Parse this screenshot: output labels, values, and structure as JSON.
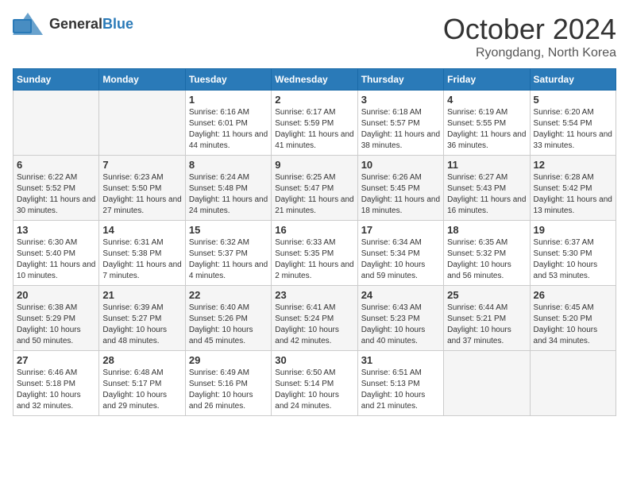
{
  "header": {
    "logo_general": "General",
    "logo_blue": "Blue",
    "month": "October 2024",
    "location": "Ryongdang, North Korea"
  },
  "weekdays": [
    "Sunday",
    "Monday",
    "Tuesday",
    "Wednesday",
    "Thursday",
    "Friday",
    "Saturday"
  ],
  "weeks": [
    [
      {
        "day": "",
        "sunrise": "",
        "sunset": "",
        "daylight": ""
      },
      {
        "day": "",
        "sunrise": "",
        "sunset": "",
        "daylight": ""
      },
      {
        "day": "1",
        "sunrise": "Sunrise: 6:16 AM",
        "sunset": "Sunset: 6:01 PM",
        "daylight": "Daylight: 11 hours and 44 minutes."
      },
      {
        "day": "2",
        "sunrise": "Sunrise: 6:17 AM",
        "sunset": "Sunset: 5:59 PM",
        "daylight": "Daylight: 11 hours and 41 minutes."
      },
      {
        "day": "3",
        "sunrise": "Sunrise: 6:18 AM",
        "sunset": "Sunset: 5:57 PM",
        "daylight": "Daylight: 11 hours and 38 minutes."
      },
      {
        "day": "4",
        "sunrise": "Sunrise: 6:19 AM",
        "sunset": "Sunset: 5:55 PM",
        "daylight": "Daylight: 11 hours and 36 minutes."
      },
      {
        "day": "5",
        "sunrise": "Sunrise: 6:20 AM",
        "sunset": "Sunset: 5:54 PM",
        "daylight": "Daylight: 11 hours and 33 minutes."
      }
    ],
    [
      {
        "day": "6",
        "sunrise": "Sunrise: 6:22 AM",
        "sunset": "Sunset: 5:52 PM",
        "daylight": "Daylight: 11 hours and 30 minutes."
      },
      {
        "day": "7",
        "sunrise": "Sunrise: 6:23 AM",
        "sunset": "Sunset: 5:50 PM",
        "daylight": "Daylight: 11 hours and 27 minutes."
      },
      {
        "day": "8",
        "sunrise": "Sunrise: 6:24 AM",
        "sunset": "Sunset: 5:48 PM",
        "daylight": "Daylight: 11 hours and 24 minutes."
      },
      {
        "day": "9",
        "sunrise": "Sunrise: 6:25 AM",
        "sunset": "Sunset: 5:47 PM",
        "daylight": "Daylight: 11 hours and 21 minutes."
      },
      {
        "day": "10",
        "sunrise": "Sunrise: 6:26 AM",
        "sunset": "Sunset: 5:45 PM",
        "daylight": "Daylight: 11 hours and 18 minutes."
      },
      {
        "day": "11",
        "sunrise": "Sunrise: 6:27 AM",
        "sunset": "Sunset: 5:43 PM",
        "daylight": "Daylight: 11 hours and 16 minutes."
      },
      {
        "day": "12",
        "sunrise": "Sunrise: 6:28 AM",
        "sunset": "Sunset: 5:42 PM",
        "daylight": "Daylight: 11 hours and 13 minutes."
      }
    ],
    [
      {
        "day": "13",
        "sunrise": "Sunrise: 6:30 AM",
        "sunset": "Sunset: 5:40 PM",
        "daylight": "Daylight: 11 hours and 10 minutes."
      },
      {
        "day": "14",
        "sunrise": "Sunrise: 6:31 AM",
        "sunset": "Sunset: 5:38 PM",
        "daylight": "Daylight: 11 hours and 7 minutes."
      },
      {
        "day": "15",
        "sunrise": "Sunrise: 6:32 AM",
        "sunset": "Sunset: 5:37 PM",
        "daylight": "Daylight: 11 hours and 4 minutes."
      },
      {
        "day": "16",
        "sunrise": "Sunrise: 6:33 AM",
        "sunset": "Sunset: 5:35 PM",
        "daylight": "Daylight: 11 hours and 2 minutes."
      },
      {
        "day": "17",
        "sunrise": "Sunrise: 6:34 AM",
        "sunset": "Sunset: 5:34 PM",
        "daylight": "Daylight: 10 hours and 59 minutes."
      },
      {
        "day": "18",
        "sunrise": "Sunrise: 6:35 AM",
        "sunset": "Sunset: 5:32 PM",
        "daylight": "Daylight: 10 hours and 56 minutes."
      },
      {
        "day": "19",
        "sunrise": "Sunrise: 6:37 AM",
        "sunset": "Sunset: 5:30 PM",
        "daylight": "Daylight: 10 hours and 53 minutes."
      }
    ],
    [
      {
        "day": "20",
        "sunrise": "Sunrise: 6:38 AM",
        "sunset": "Sunset: 5:29 PM",
        "daylight": "Daylight: 10 hours and 50 minutes."
      },
      {
        "day": "21",
        "sunrise": "Sunrise: 6:39 AM",
        "sunset": "Sunset: 5:27 PM",
        "daylight": "Daylight: 10 hours and 48 minutes."
      },
      {
        "day": "22",
        "sunrise": "Sunrise: 6:40 AM",
        "sunset": "Sunset: 5:26 PM",
        "daylight": "Daylight: 10 hours and 45 minutes."
      },
      {
        "day": "23",
        "sunrise": "Sunrise: 6:41 AM",
        "sunset": "Sunset: 5:24 PM",
        "daylight": "Daylight: 10 hours and 42 minutes."
      },
      {
        "day": "24",
        "sunrise": "Sunrise: 6:43 AM",
        "sunset": "Sunset: 5:23 PM",
        "daylight": "Daylight: 10 hours and 40 minutes."
      },
      {
        "day": "25",
        "sunrise": "Sunrise: 6:44 AM",
        "sunset": "Sunset: 5:21 PM",
        "daylight": "Daylight: 10 hours and 37 minutes."
      },
      {
        "day": "26",
        "sunrise": "Sunrise: 6:45 AM",
        "sunset": "Sunset: 5:20 PM",
        "daylight": "Daylight: 10 hours and 34 minutes."
      }
    ],
    [
      {
        "day": "27",
        "sunrise": "Sunrise: 6:46 AM",
        "sunset": "Sunset: 5:18 PM",
        "daylight": "Daylight: 10 hours and 32 minutes."
      },
      {
        "day": "28",
        "sunrise": "Sunrise: 6:48 AM",
        "sunset": "Sunset: 5:17 PM",
        "daylight": "Daylight: 10 hours and 29 minutes."
      },
      {
        "day": "29",
        "sunrise": "Sunrise: 6:49 AM",
        "sunset": "Sunset: 5:16 PM",
        "daylight": "Daylight: 10 hours and 26 minutes."
      },
      {
        "day": "30",
        "sunrise": "Sunrise: 6:50 AM",
        "sunset": "Sunset: 5:14 PM",
        "daylight": "Daylight: 10 hours and 24 minutes."
      },
      {
        "day": "31",
        "sunrise": "Sunrise: 6:51 AM",
        "sunset": "Sunset: 5:13 PM",
        "daylight": "Daylight: 10 hours and 21 minutes."
      },
      {
        "day": "",
        "sunrise": "",
        "sunset": "",
        "daylight": ""
      },
      {
        "day": "",
        "sunrise": "",
        "sunset": "",
        "daylight": ""
      }
    ]
  ]
}
